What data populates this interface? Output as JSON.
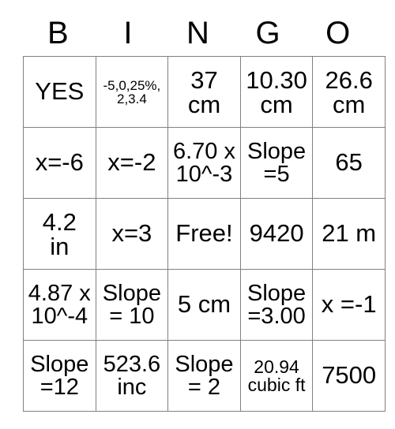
{
  "card": {
    "headers": [
      "B",
      "I",
      "N",
      "G",
      "O"
    ],
    "rows": [
      [
        {
          "lines": [
            "YES"
          ],
          "size": "lg"
        },
        {
          "lines": [
            "-5,0,25%,",
            "2,3.4"
          ],
          "size": "xs"
        },
        {
          "lines": [
            "37",
            "cm"
          ],
          "size": "lg"
        },
        {
          "lines": [
            "10.30",
            "cm"
          ],
          "size": "lg"
        },
        {
          "lines": [
            "26.6",
            "cm"
          ],
          "size": "lg"
        }
      ],
      [
        {
          "lines": [
            "x=-6"
          ],
          "size": "lg"
        },
        {
          "lines": [
            "x=-2"
          ],
          "size": "lg"
        },
        {
          "lines": [
            "6.70 x",
            "10^-3"
          ],
          "size": "md"
        },
        {
          "lines": [
            "Slope",
            "=5"
          ],
          "size": "md"
        },
        {
          "lines": [
            "65"
          ],
          "size": "lg"
        }
      ],
      [
        {
          "lines": [
            "4.2",
            "in"
          ],
          "size": "lg"
        },
        {
          "lines": [
            "x=3"
          ],
          "size": "lg"
        },
        {
          "lines": [
            "Free!"
          ],
          "size": "lg"
        },
        {
          "lines": [
            "9420"
          ],
          "size": "lg"
        },
        {
          "lines": [
            "21 m"
          ],
          "size": "lg"
        }
      ],
      [
        {
          "lines": [
            "4.87 x",
            "10^-4"
          ],
          "size": "md"
        },
        {
          "lines": [
            "Slope",
            "= 10"
          ],
          "size": "md"
        },
        {
          "lines": [
            "5 cm"
          ],
          "size": "lg"
        },
        {
          "lines": [
            "Slope",
            "=3.00"
          ],
          "size": "md"
        },
        {
          "lines": [
            "x =-1"
          ],
          "size": "lg"
        }
      ],
      [
        {
          "lines": [
            "Slope",
            "=12"
          ],
          "size": "md"
        },
        {
          "lines": [
            "523.6",
            "inc"
          ],
          "size": "md"
        },
        {
          "lines": [
            "Slope",
            "= 2"
          ],
          "size": "md"
        },
        {
          "lines": [
            "20.94",
            "cubic ft"
          ],
          "size": "sm"
        },
        {
          "lines": [
            "7500"
          ],
          "size": "lg"
        }
      ]
    ],
    "colors": {
      "border": "#808080",
      "text": "#000000",
      "background": "#ffffff"
    }
  }
}
